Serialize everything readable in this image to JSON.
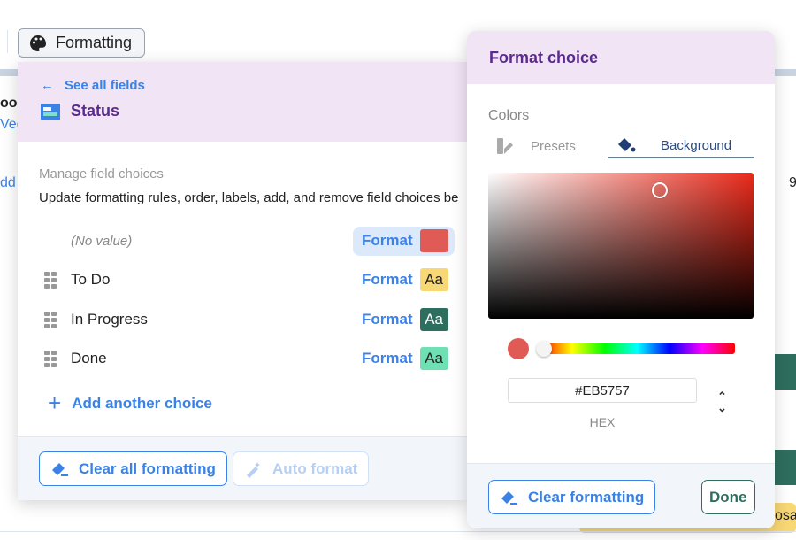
{
  "background": {
    "fragments": [
      "oon",
      "Vee",
      "dd",
      "9",
      "osal"
    ]
  },
  "toolbar": {
    "formatting_label": "Formatting"
  },
  "field_panel": {
    "back_label": "See all fields",
    "field_name": "Status",
    "section_title": "Manage field choices",
    "description": "Update formatting rules, order, labels, add, and remove field choices be",
    "format_label": "Format",
    "choices": [
      {
        "label": "(No value)",
        "swatch_text": "",
        "swatch_color": "#E05B55",
        "text_color": "#222",
        "active": true
      },
      {
        "label": "To Do",
        "swatch_text": "Aa",
        "swatch_color": "#F8D775",
        "text_color": "#222"
      },
      {
        "label": "In Progress",
        "swatch_text": "Aa",
        "swatch_color": "#2E6E5E",
        "text_color": "#ffffff"
      },
      {
        "label": "Done",
        "swatch_text": "Aa",
        "swatch_color": "#6EE0B4",
        "text_color": "#222"
      }
    ],
    "add_choice_label": "Add another choice",
    "clear_all_label": "Clear all formatting",
    "auto_format_label": "Auto format"
  },
  "format_panel": {
    "title": "Format choice",
    "colors_label": "Colors",
    "tabs": [
      {
        "label": "Presets",
        "active": false
      },
      {
        "label": "Background",
        "active": true
      }
    ],
    "hex_value": "#EB5757",
    "hex_label": "HEX",
    "selected_color": "#EB5757",
    "clear_label": "Clear formatting",
    "done_label": "Done"
  },
  "colors": {
    "accent": "#3B82E6",
    "header_bg": "#F0E4F5",
    "title": "#5B2A8E",
    "done_green": "#2E6E5E"
  }
}
